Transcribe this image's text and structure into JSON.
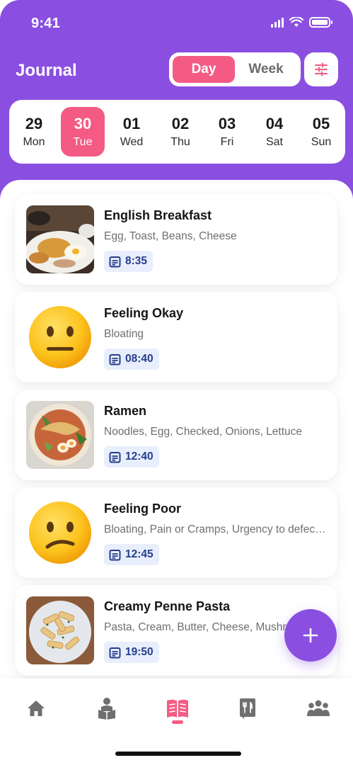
{
  "status_bar": {
    "time": "9:41"
  },
  "header": {
    "title": "Journal",
    "toggle": {
      "day_label": "Day",
      "week_label": "Week",
      "selected": "Day"
    },
    "filter_icon": "sliders-icon"
  },
  "dates": [
    {
      "num": "29",
      "day": "Mon"
    },
    {
      "num": "30",
      "day": "Tue",
      "selected": true
    },
    {
      "num": "01",
      "day": "Wed"
    },
    {
      "num": "02",
      "day": "Thu"
    },
    {
      "num": "03",
      "day": "Fri"
    },
    {
      "num": "04",
      "day": "Sat"
    },
    {
      "num": "05",
      "day": "Sun"
    }
  ],
  "entries": [
    {
      "title": "English Breakfast",
      "subtitle": "Egg, Toast, Beans, Cheese",
      "time": "8:35",
      "kind": "meal"
    },
    {
      "title": "Feeling Okay",
      "subtitle": "Bloating",
      "time": "08:40",
      "kind": "feeling-neutral"
    },
    {
      "title": "Ramen",
      "subtitle": "Noodles, Egg, Checked, Onions, Lettuce",
      "time": "12:40",
      "kind": "meal"
    },
    {
      "title": "Feeling Poor",
      "subtitle": "Bloating, Pain or Cramps, Urgency to defecate",
      "time": "12:45",
      "kind": "feeling-poor"
    },
    {
      "title": "Creamy Penne Pasta",
      "subtitle": "Pasta, Cream, Butter, Cheese, Mushrooms",
      "time": "19:50",
      "kind": "meal"
    }
  ],
  "fab": {
    "icon": "plus-icon"
  },
  "bottom_nav": [
    {
      "icon": "home-icon"
    },
    {
      "icon": "reading-person-icon"
    },
    {
      "icon": "journal-book-icon",
      "active": true
    },
    {
      "icon": "menu-cutlery-icon"
    },
    {
      "icon": "community-icon"
    }
  ],
  "colors": {
    "primary": "#8a4fe0",
    "accent": "#f45b84",
    "badge_bg": "#e8eefb",
    "badge_text": "#263d8c"
  }
}
